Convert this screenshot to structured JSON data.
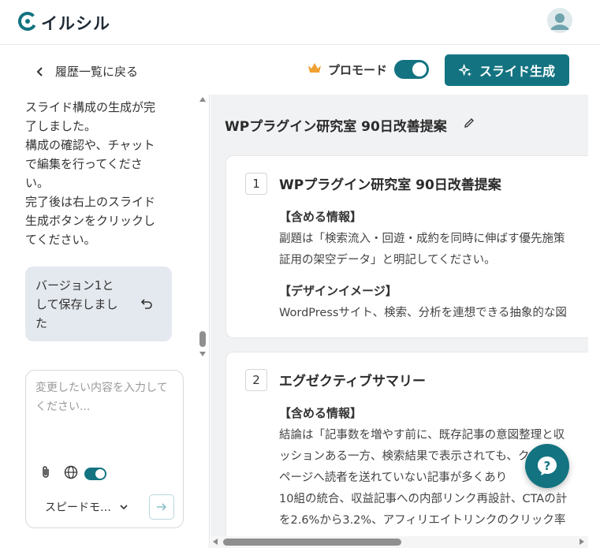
{
  "brand": {
    "name": "イルシル",
    "accent": "#137381"
  },
  "toolbar": {
    "back_label": "履歴一覧に戻る",
    "pro_mode_label": "プロモード",
    "pro_mode_on": true,
    "generate_label": "スライド生成"
  },
  "chat": {
    "assistant_lines": [
      "スライド構成の生成が完",
      "了しました。",
      "構成の確認や、チャット",
      "で編集を行ってくださ",
      "い。",
      "完了後は右上のスライド",
      "生成ボタンをクリックし",
      "てください。"
    ],
    "bubble_lines": [
      "バージョン1と",
      "して保存しまし",
      "た"
    ],
    "input_placeholder": "変更したい内容を入力してください...",
    "web_toggle_on": true,
    "mode_label": "スピードモ…"
  },
  "document": {
    "title": "WPプラグイン研究室 90日改善提案",
    "slides": [
      {
        "number": "1",
        "title": "WPプラグイン研究室 90日改善提案",
        "section1": "【含める情報】",
        "lines1": [
          "副題は「検索流入・回遊・成約を同時に伸ばす優先施策",
          "証用の架空データ」と明記してください。"
        ],
        "section2": "【デザインイメージ】",
        "lines2": [
          "WordPressサイト、検索、分析を連想できる抽象的な図"
        ]
      },
      {
        "number": "2",
        "title": "エグゼクティブサマリー",
        "section1": "【含める情報】",
        "lines1": [
          "結論は「記事数を増やす前に、既存記事の意図整理と収",
          "ッションある一方、検索結果で表示されても、クリック",
          "ページへ読者を送れていない記事が多くあり　　90日",
          "10組の統合、収益記事への内部リンク再設計、CTAの計",
          "を2.6%から3.2%、アフィリエイトリンクのクリック率"
        ]
      }
    ]
  }
}
